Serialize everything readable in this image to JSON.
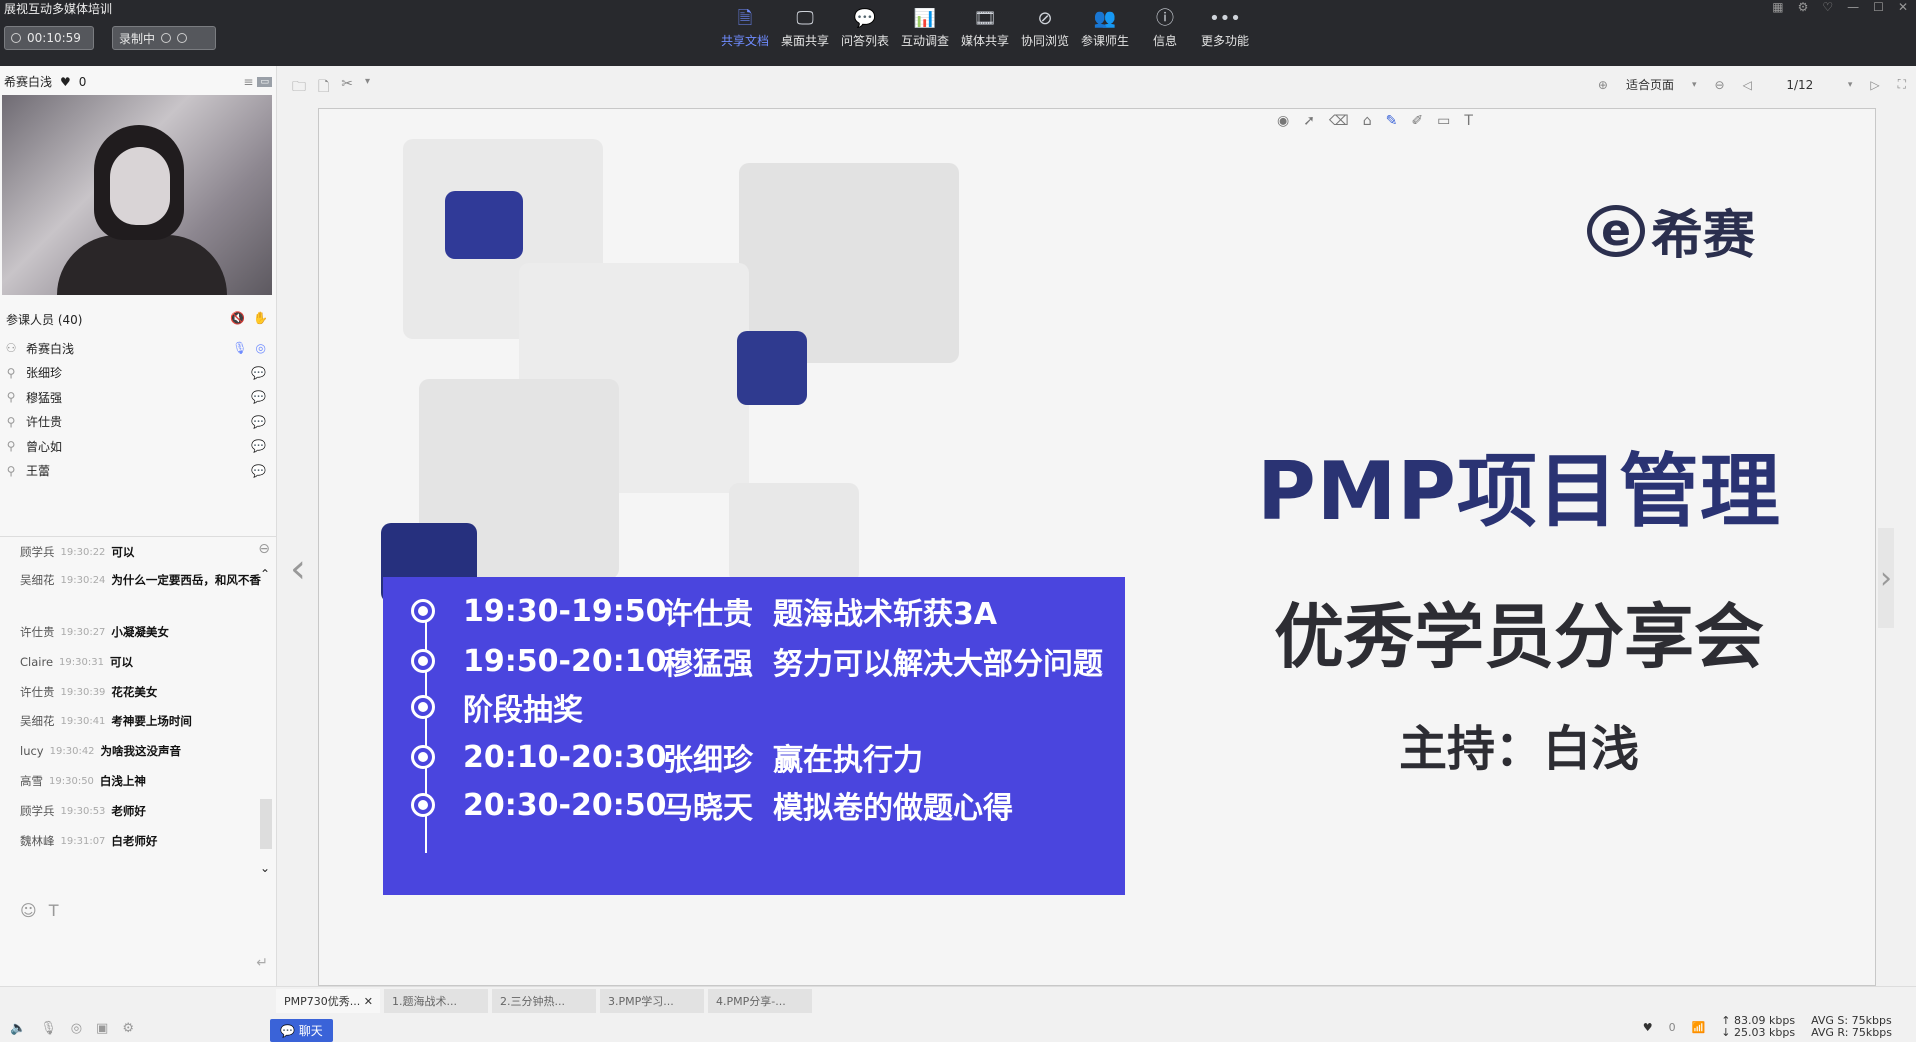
{
  "app": {
    "title": "展视互动多媒体培训"
  },
  "topbar": {
    "timer": "00:10:59",
    "recording": "录制中",
    "toolbar": [
      {
        "label": "共享文档",
        "icon": "doc-icon",
        "glyph": "🗎",
        "active": true
      },
      {
        "label": "桌面共享",
        "icon": "desktop-icon",
        "glyph": "🖵",
        "active": false
      },
      {
        "label": "问答列表",
        "icon": "qa-icon",
        "glyph": "💬",
        "active": false
      },
      {
        "label": "互动调查",
        "icon": "survey-icon",
        "glyph": "📊",
        "active": false
      },
      {
        "label": "媒体共享",
        "icon": "media-icon",
        "glyph": "🎞",
        "active": false
      },
      {
        "label": "协同浏览",
        "icon": "browse-icon",
        "glyph": "⊘",
        "active": false
      },
      {
        "label": "参课师生",
        "icon": "people-icon",
        "glyph": "👥",
        "active": false
      },
      {
        "label": "信息",
        "icon": "info-icon",
        "glyph": "ⓘ",
        "active": false
      },
      {
        "label": "更多功能",
        "icon": "more-icon",
        "glyph": "•••",
        "active": false
      }
    ]
  },
  "left": {
    "host_name": "希赛白浅",
    "likes": "0",
    "participants_header": "参课人员 (40)",
    "participants": [
      {
        "name": "希赛白浅",
        "icon": "presenter-icon",
        "glyph": "⚇"
      },
      {
        "name": "张细珍",
        "icon": "user-icon",
        "glyph": "⚲"
      },
      {
        "name": "穆猛强",
        "icon": "user-icon",
        "glyph": "⚲"
      },
      {
        "name": "许仕贵",
        "icon": "user-icon",
        "glyph": "⚲"
      },
      {
        "name": "曾心如",
        "icon": "user-icon",
        "glyph": "⚲"
      },
      {
        "name": "王蕾",
        "icon": "user-icon",
        "glyph": "⚲"
      }
    ],
    "chat": [
      {
        "who": "顾学兵",
        "time": "19:30:22",
        "text": "可以"
      },
      {
        "who": "吴细花",
        "time": "19:30:24",
        "text": "为什么一定要西岳，和风不香"
      },
      {
        "who": "许仕贵",
        "time": "19:30:27",
        "text": "小凝凝美女"
      },
      {
        "who": "Claire",
        "time": "19:30:31",
        "text": "可以"
      },
      {
        "who": "许仕贵",
        "time": "19:30:39",
        "text": "花花美女"
      },
      {
        "who": "吴细花",
        "time": "19:30:41",
        "text": "考神要上场时间"
      },
      {
        "who": "lucy",
        "time": "19:30:42",
        "text": "为啥我这没声音"
      },
      {
        "who": "高雪",
        "time": "19:30:50",
        "text": "白浅上神"
      },
      {
        "who": "顾学兵",
        "time": "19:30:53",
        "text": "老师好"
      },
      {
        "who": "魏林峰",
        "time": "19:31:07",
        "text": "白老师好"
      }
    ]
  },
  "doc": {
    "fit_label": "适合页面",
    "page": "1/12",
    "slide": {
      "logo": "希赛",
      "title": "PMP项目管理",
      "subtitle": "优秀学员分享会",
      "host": "主持：白浅",
      "schedule": [
        {
          "time": "19:30-19:50",
          "name": "许仕贵",
          "topic": "题海战术斩获3A"
        },
        {
          "time": "19:50-20:10",
          "name": "穆猛强",
          "topic": "努力可以解决大部分问题"
        },
        {
          "time": "",
          "name": "",
          "topic": "阶段抽奖"
        },
        {
          "time": "20:10-20:30",
          "name": "张细珍",
          "topic": "赢在执行力"
        },
        {
          "time": "20:30-20:50",
          "name": "马晓天",
          "topic": "模拟卷的做题心得"
        }
      ]
    },
    "tabs": [
      "PMP730优秀...",
      "1.题海战术...",
      "2.三分钟热...",
      "3.PMP学习...",
      "4.PMP分享-..."
    ]
  },
  "bottom": {
    "chat_button": "聊天",
    "likes": "0",
    "send_rate": "83.09 kbps",
    "recv_rate": "25.03 kbps",
    "avg_s": "AVG S: 75kbps",
    "avg_r": "AVG R: 75kbps"
  }
}
